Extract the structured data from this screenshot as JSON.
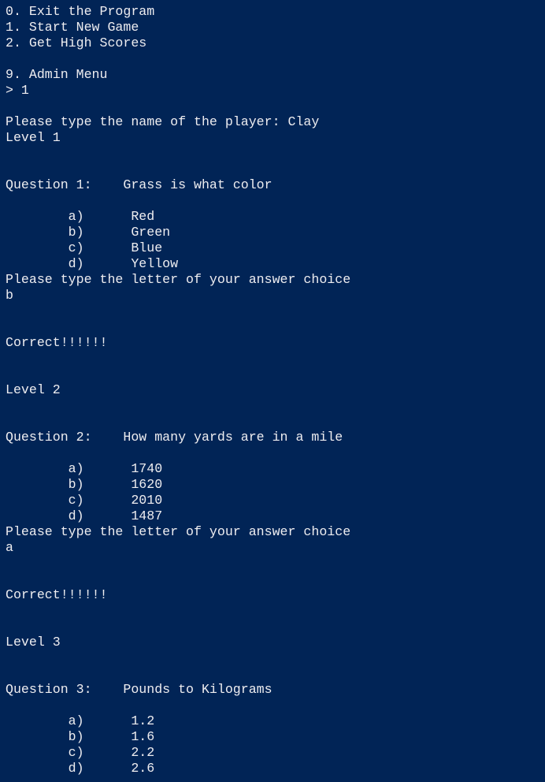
{
  "console": {
    "background": "#012456",
    "foreground": "#eeedf0",
    "lines": [
      "0. Exit the Program",
      "1. Start New Game",
      "2. Get High Scores",
      "",
      "9. Admin Menu",
      "> 1",
      "",
      "Please type the name of the player: Clay",
      "Level 1",
      "",
      "",
      "Question 1:    Grass is what color",
      "",
      "        a)      Red",
      "        b)      Green",
      "        c)      Blue",
      "        d)      Yellow",
      "Please type the letter of your answer choice",
      "b",
      "",
      "",
      "Correct!!!!!!",
      "",
      "",
      "Level 2",
      "",
      "",
      "Question 2:    How many yards are in a mile",
      "",
      "        a)      1740",
      "        b)      1620",
      "        c)      2010",
      "        d)      1487",
      "Please type the letter of your answer choice",
      "a",
      "",
      "",
      "Correct!!!!!!",
      "",
      "",
      "Level 3",
      "",
      "",
      "Question 3:    Pounds to Kilograms",
      "",
      "        a)      1.2",
      "        b)      1.6",
      "        c)      2.2",
      "        d)      2.6"
    ]
  }
}
